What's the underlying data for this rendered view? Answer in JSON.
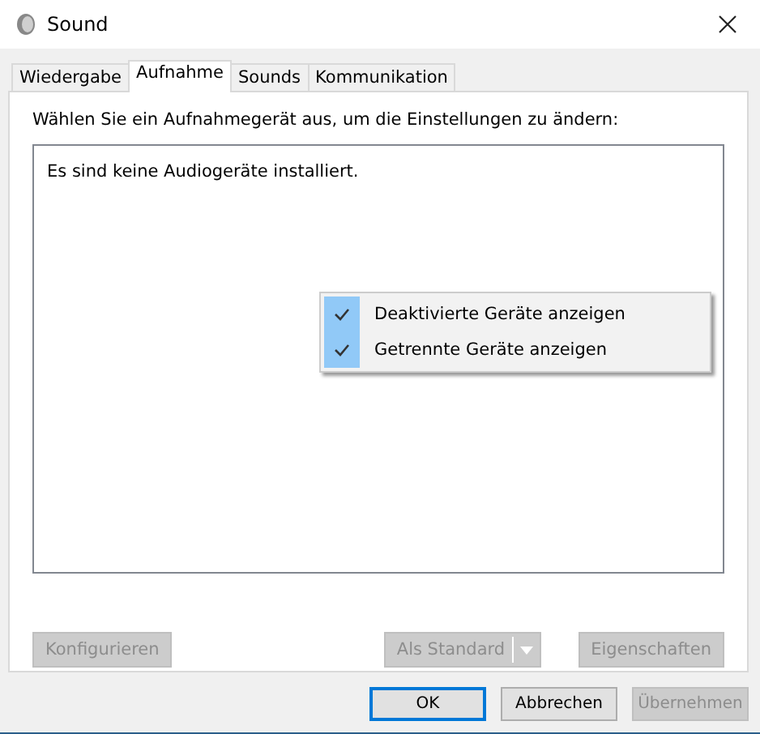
{
  "window": {
    "title": "Sound"
  },
  "tabs": [
    {
      "label": "Wiedergabe",
      "selected": false
    },
    {
      "label": "Aufnahme",
      "selected": true
    },
    {
      "label": "Sounds",
      "selected": false
    },
    {
      "label": "Kommunikation",
      "selected": false
    }
  ],
  "instruction": "Wählen Sie ein Aufnahmegerät aus, um die Einstellungen zu ändern:",
  "device_list": {
    "empty_message": "Es sind keine Audiogeräte installiert."
  },
  "context_menu": [
    {
      "label": "Deaktivierte Geräte anzeigen",
      "checked": true
    },
    {
      "label": "Getrennte Geräte anzeigen",
      "checked": true
    }
  ],
  "panel_buttons": [
    {
      "label": "Konfigurieren",
      "kind": "plain",
      "disabled": true
    },
    {
      "label": "Als Standard",
      "kind": "split",
      "disabled": true
    },
    {
      "label": "Eigenschaften",
      "kind": "plain",
      "disabled": true
    }
  ],
  "dialog_buttons": [
    {
      "label": "OK",
      "focused": true,
      "disabled": false
    },
    {
      "label": "Abbrechen",
      "focused": false,
      "disabled": false
    },
    {
      "label": "Übernehmen",
      "focused": false,
      "disabled": true
    }
  ]
}
